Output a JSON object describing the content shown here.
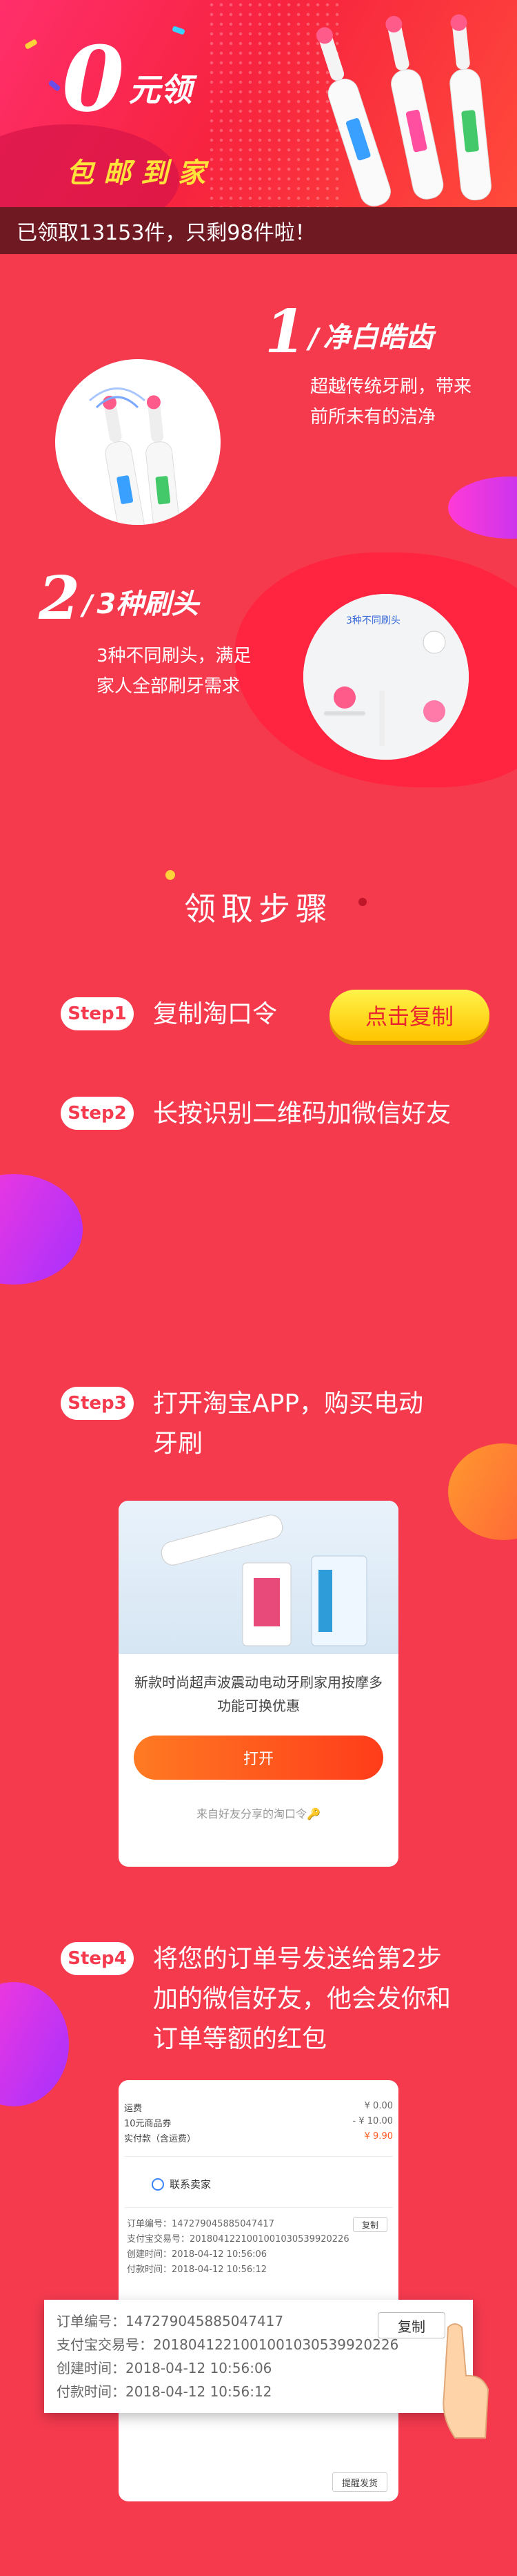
{
  "hero": {
    "zero": "0",
    "yuan": "元领",
    "subtitle": "包邮到家",
    "status_text": "已领取13153件，只剩98件啦！"
  },
  "features": [
    {
      "num": "1",
      "title": "净白皓齿",
      "desc": [
        "超越传统牙刷，带来",
        "前所未有的洁净"
      ]
    },
    {
      "num": "2",
      "title": "3种刷头",
      "desc": [
        "3种不同刷头，满足",
        "家人全部刷牙需求"
      ]
    }
  ],
  "feature_photo_caption": "3种不同刷头",
  "section_title": "领取步骤",
  "steps": [
    {
      "badge": "Step1",
      "text": [
        "复制淘口令"
      ]
    },
    {
      "badge": "Step2",
      "text": [
        "长按识别二维码加微信好友"
      ]
    },
    {
      "badge": "Step3",
      "text": [
        "打开淘宝APP，购买电动",
        "牙刷"
      ]
    },
    {
      "badge": "Step4",
      "text": [
        "将您的订单号发送给第2步",
        "加的微信好友，他会发你和",
        "订单等额的红包"
      ]
    }
  ],
  "copy_button": "点击复制",
  "card1": {
    "desc": "新款时尚超声波震动电动牙刷家用按摩多功能可换优惠",
    "open_button": "打开",
    "footnote": "来自好友分享的淘口令🔑"
  },
  "card2": {
    "rows": [
      {
        "l": "运费",
        "r": "¥ 0.00"
      },
      {
        "l": "10元商品券",
        "r": "- ¥ 10.00"
      },
      {
        "l": "实付款（含运费）",
        "r": "¥ 9.90"
      }
    ],
    "contact": "联系卖家",
    "copy_small": "复制",
    "details": [
      "订单编号：147279045885047417",
      "支付宝交易号：2018041221001001030539920226",
      "创建时间：2018-04-12 10:56:06",
      "付款时间：2018-04-12 10:56:12"
    ],
    "remind": "提醒发货"
  },
  "zoom": {
    "rows": [
      "订单编号：147279045885047417",
      "支付宝交易号：2018041221001001030539920226",
      "创建时间：2018-04-12 10:56:06",
      "付款时间：2018-04-12 10:56:12"
    ],
    "copy": "复制"
  },
  "colors": {
    "background": "#f53a4e",
    "accent_yellow": "#ffe23a",
    "button_orange": "#ff5a1f"
  }
}
